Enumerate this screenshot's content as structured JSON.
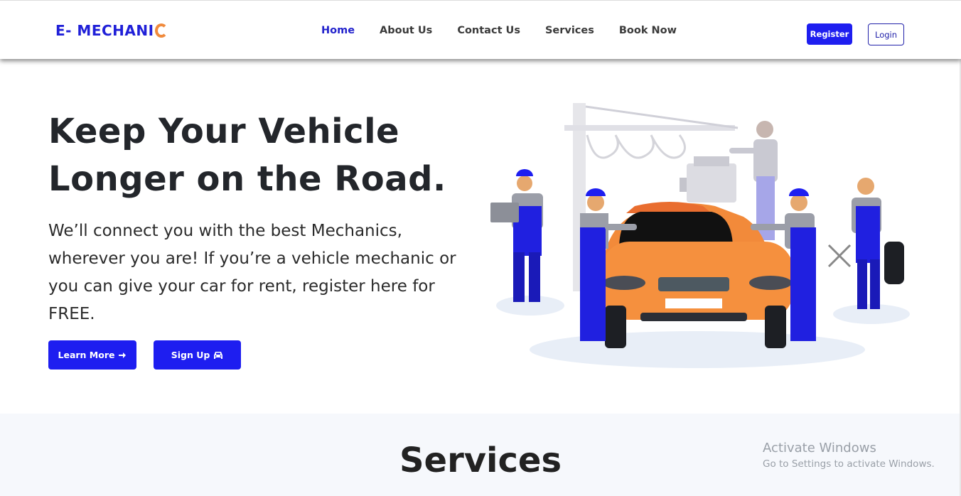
{
  "brand": {
    "logo_text": "E- MECHANI",
    "accent_color": "#1e1ef0",
    "logo_c_color": "#f08a3c"
  },
  "nav": {
    "items": [
      "Home",
      "About Us",
      "Contact Us",
      "Services",
      "Book Now"
    ],
    "active": "Home"
  },
  "header_actions": {
    "register_label": "Register",
    "login_label": "Login"
  },
  "hero": {
    "title": "Keep Your Vehicle Longer on the Road.",
    "text": "We’ll connect you with the best Mechanics, wherever you are! If you’re a vehicle mechanic or you can give your car for rent, register here for FREE.",
    "learn_more_label": "Learn More",
    "learn_more_icon": "arrow-right-icon",
    "sign_up_label": "Sign Up",
    "sign_up_icon": "car-icon",
    "illustration": "mechanics-repairing-car-illustration"
  },
  "services": {
    "title": "Services"
  },
  "watermark": {
    "line1": "Activate Windows",
    "line2": "Go to Settings to activate Windows."
  }
}
